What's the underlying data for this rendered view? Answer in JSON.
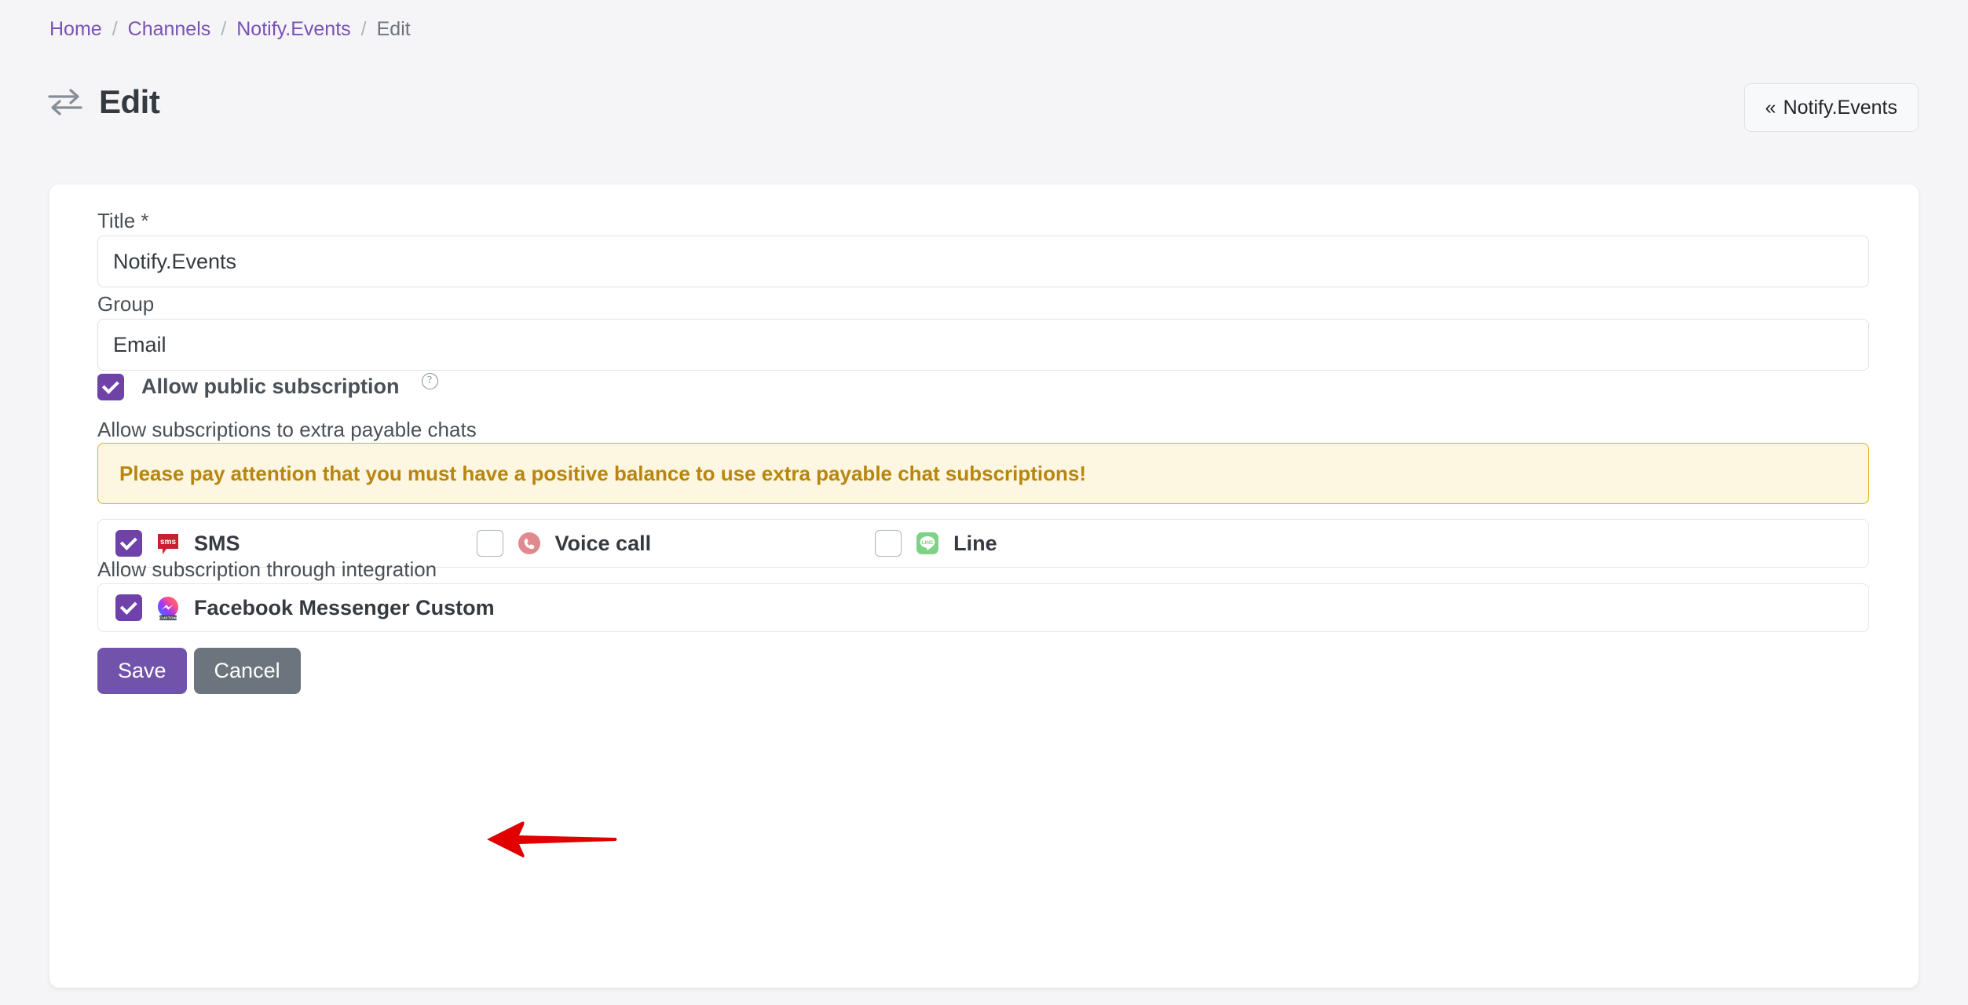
{
  "breadcrumb": {
    "items": [
      {
        "label": "Home",
        "current": false
      },
      {
        "label": "Channels",
        "current": false
      },
      {
        "label": "Notify.Events",
        "current": false
      },
      {
        "label": "Edit",
        "current": true
      }
    ],
    "separator": "/"
  },
  "header": {
    "icon": "exchange-icon",
    "title": "Edit",
    "back_button": {
      "label": "Notify.Events",
      "chevrons": "«"
    }
  },
  "form": {
    "title_field": {
      "label": "Title *",
      "value": "Notify.Events",
      "placeholder": "Title"
    },
    "group_field": {
      "label": "Group",
      "value": "Email",
      "placeholder": "Group"
    },
    "public_subscription": {
      "label": "Allow public subscription",
      "checked": true,
      "help_icon": "?"
    },
    "payable_section": {
      "label": "Allow subscriptions to extra payable chats",
      "warning": "Please pay attention that you must have a positive balance to use extra payable chat subscriptions!",
      "channels": [
        {
          "name": "SMS",
          "icon": "sms-icon",
          "checked": true
        },
        {
          "name": "Voice call",
          "icon": "voice-call-icon",
          "checked": false
        },
        {
          "name": "Line",
          "icon": "line-icon",
          "checked": false
        }
      ]
    },
    "integration_section": {
      "label": "Allow subscription through integration",
      "items": [
        {
          "name": "Facebook Messenger Custom",
          "icon": "messenger-custom-icon",
          "badge": "CUSTOM",
          "checked": true
        }
      ]
    },
    "actions": {
      "save_label": "Save",
      "cancel_label": "Cancel"
    }
  },
  "annotation": {
    "type": "arrow",
    "direction": "left",
    "color": "#e00000"
  },
  "colors": {
    "accent_purple": "#6f42a8",
    "link_purple": "#7952b3",
    "save_purple": "#7253ab",
    "cancel_gray": "#6c757d",
    "warning_bg": "#fdf6e0",
    "warning_border": "#e2ae30",
    "warning_text": "#b8860e",
    "page_bg": "#f5f4f7",
    "annotation_red": "#e00000"
  }
}
